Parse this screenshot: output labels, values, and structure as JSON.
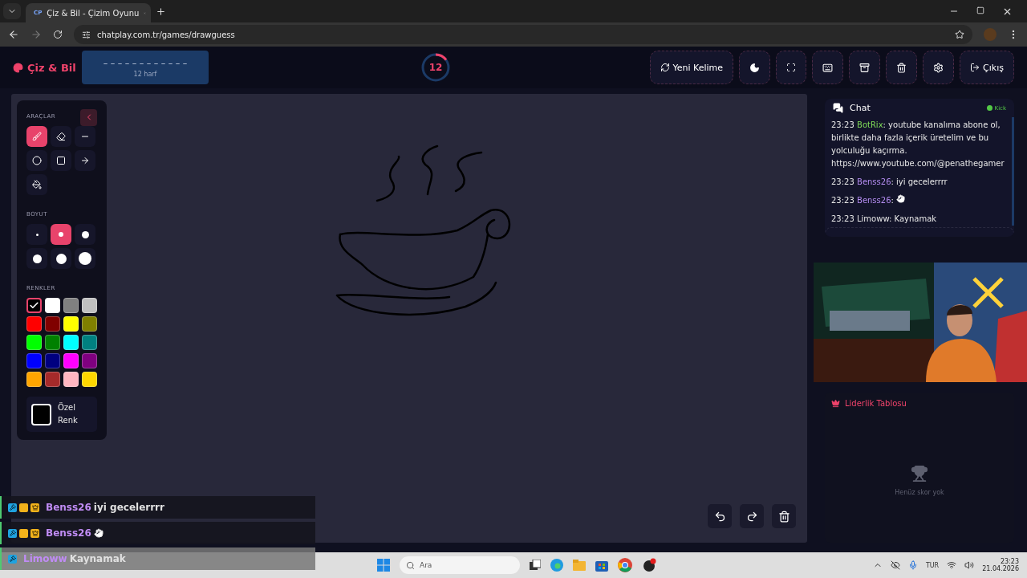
{
  "browser": {
    "favicon": "CP",
    "tab_title": "Çiz & Bil - Çizim Oyunu",
    "url": "chatplay.com.tr/games/drawguess"
  },
  "header": {
    "logo": "Çiz & Bil",
    "word_hint": "– – – – – – – – – – – –",
    "letter_count": "12 harf",
    "timer": {
      "value": "12",
      "level": 0.15
    },
    "buttons": [
      {
        "kind": "new-word",
        "label": "Yeni Kelime"
      },
      {
        "kind": "theme"
      },
      {
        "kind": "fullscreen"
      },
      {
        "kind": "keyboard"
      },
      {
        "kind": "archive"
      },
      {
        "kind": "trash"
      },
      {
        "kind": "settings"
      },
      {
        "kind": "exit",
        "label": "Çıkış"
      }
    ]
  },
  "tools_panel": {
    "title": "ARAÇLAR",
    "tools": [
      {
        "kind": "brush",
        "selected": true
      },
      {
        "kind": "eraser",
        "selected": false
      },
      {
        "kind": "line",
        "selected": false
      },
      {
        "kind": "circle",
        "selected": false
      },
      {
        "kind": "rectangle",
        "selected": false
      },
      {
        "kind": "arrow",
        "selected": false
      },
      {
        "kind": "fill",
        "selected": false
      }
    ],
    "size_title": "BOYUT",
    "sizes": [
      {
        "selected": false
      },
      {
        "selected": true
      },
      {
        "selected": false
      },
      {
        "selected": false
      },
      {
        "selected": false
      },
      {
        "selected": false
      }
    ],
    "colors_title": "RENKLER",
    "colors": [
      {
        "color": "#000000",
        "selected": true
      },
      {
        "color": "#ffffff",
        "selected": false
      },
      {
        "color": "#808080",
        "selected": false
      },
      {
        "color": "#c0c0c0",
        "selected": false
      },
      {
        "color": "#ff0000",
        "selected": false
      },
      {
        "color": "#800000",
        "selected": false
      },
      {
        "color": "#ffff00",
        "selected": false
      },
      {
        "color": "#808000",
        "selected": false
      },
      {
        "color": "#00ff00",
        "selected": false
      },
      {
        "color": "#008000",
        "selected": false
      },
      {
        "color": "#00ffff",
        "selected": false
      },
      {
        "color": "#008080",
        "selected": false
      },
      {
        "color": "#0000ff",
        "selected": false
      },
      {
        "color": "#000080",
        "selected": false
      },
      {
        "color": "#ff00ff",
        "selected": false
      },
      {
        "color": "#800080",
        "selected": false
      },
      {
        "color": "#ffa500",
        "selected": false
      },
      {
        "color": "#a52a2a",
        "selected": false
      },
      {
        "color": "#ffb6c1",
        "selected": false
      },
      {
        "color": "#ffd700",
        "selected": false
      }
    ],
    "custom_color": "Özel Renk"
  },
  "canvas_controls": [
    {
      "kind": "undo"
    },
    {
      "kind": "redo"
    },
    {
      "kind": "clear"
    }
  ],
  "chat": {
    "title": "Chat",
    "platform": "Kick",
    "separator": ":",
    "messages": [
      {
        "kind": "text",
        "time": "23:23",
        "user": "BotRix",
        "color": "#7ed957",
        "text": "youtube kanalıma abone ol, birlikte daha fazla içerik üretelim ve bu yolculuğu kaçırma. https://www.youtube.com/@penathegamer"
      },
      {
        "kind": "text",
        "time": "23:23",
        "user": "Benss26",
        "color": "#b48cf0",
        "text": "iyi gecelerrrr"
      },
      {
        "kind": "emote",
        "time": "23:23",
        "user": "Benss26",
        "color": "#b48cf0"
      },
      {
        "kind": "text",
        "time": "23:23",
        "user": "Limoww",
        "color": "#e6e6e6",
        "text": "Kaynamak"
      }
    ]
  },
  "leaderboard": {
    "title": "Liderlik Tablosu",
    "empty": "Henüz skor yok"
  },
  "stream_chat": [
    {
      "kind": "text",
      "user": "Benss26",
      "subscriber": true,
      "text": "iyi gecelerrrr"
    },
    {
      "kind": "emote",
      "user": "Benss26",
      "subscriber": true
    },
    {
      "kind": "text",
      "user": "Limoww",
      "subscriber": false,
      "text": "Kaynamak"
    }
  ],
  "taskbar": {
    "search_placeholder": "Ara",
    "language": "TUR",
    "time": "23:23",
    "date": "21.04.2026"
  }
}
